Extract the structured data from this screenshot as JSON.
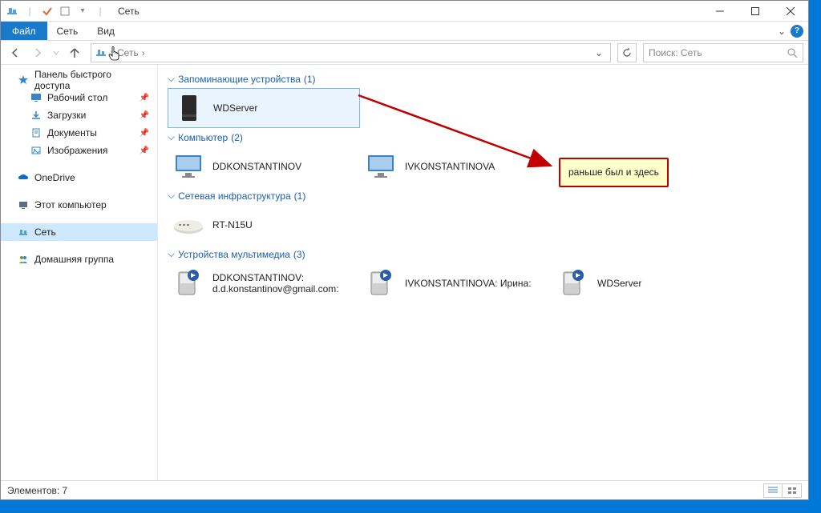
{
  "titlebar": {
    "title": "Сеть"
  },
  "ribbon": {
    "file": "Файл",
    "tabs": [
      "Сеть",
      "Вид"
    ],
    "chevron": "⌄"
  },
  "nav": {
    "back": "←",
    "forward": "→",
    "up": "↑",
    "path_label": "Сеть",
    "path_sep": "›",
    "dropdown": "⌄",
    "refresh": "⟳"
  },
  "search": {
    "placeholder": "Поиск: Сеть",
    "icon": "🔍"
  },
  "sidebar": {
    "quick_access": "Панель быстрого доступа",
    "items_quick": [
      {
        "label": "Рабочий стол"
      },
      {
        "label": "Загрузки"
      },
      {
        "label": "Документы"
      },
      {
        "label": "Изображения"
      }
    ],
    "onedrive": "OneDrive",
    "this_pc": "Этот компьютер",
    "network": "Сеть",
    "homegroup": "Домашняя группа"
  },
  "groups": {
    "storage": {
      "title": "Запоминающие устройства",
      "count": "(1)",
      "items": [
        {
          "label": "WDServer"
        }
      ]
    },
    "computer": {
      "title": "Компьютер",
      "count": "(2)",
      "items": [
        {
          "label": "DDKONSTANTINOV"
        },
        {
          "label": "IVKONSTANTINOVA"
        }
      ]
    },
    "network_infra": {
      "title": "Сетевая инфраструктура",
      "count": "(1)",
      "items": [
        {
          "label": "RT-N15U"
        }
      ]
    },
    "multimedia": {
      "title": "Устройства мультимедиа",
      "count": "(3)",
      "items": [
        {
          "label": "DDKONSTANTINOV: d.d.konstantinov@gmail.com:"
        },
        {
          "label": "IVKONSTANTINOVA: Ирина:"
        },
        {
          "label": "WDServer"
        }
      ]
    }
  },
  "status": {
    "elements": "Элементов: 7"
  },
  "annotation": {
    "text": "раньше был и здесь"
  },
  "icons": {
    "network": "📶",
    "computer": "🖥",
    "server": "▮",
    "monitor": "🖳",
    "router": "📻",
    "media": "▶"
  }
}
